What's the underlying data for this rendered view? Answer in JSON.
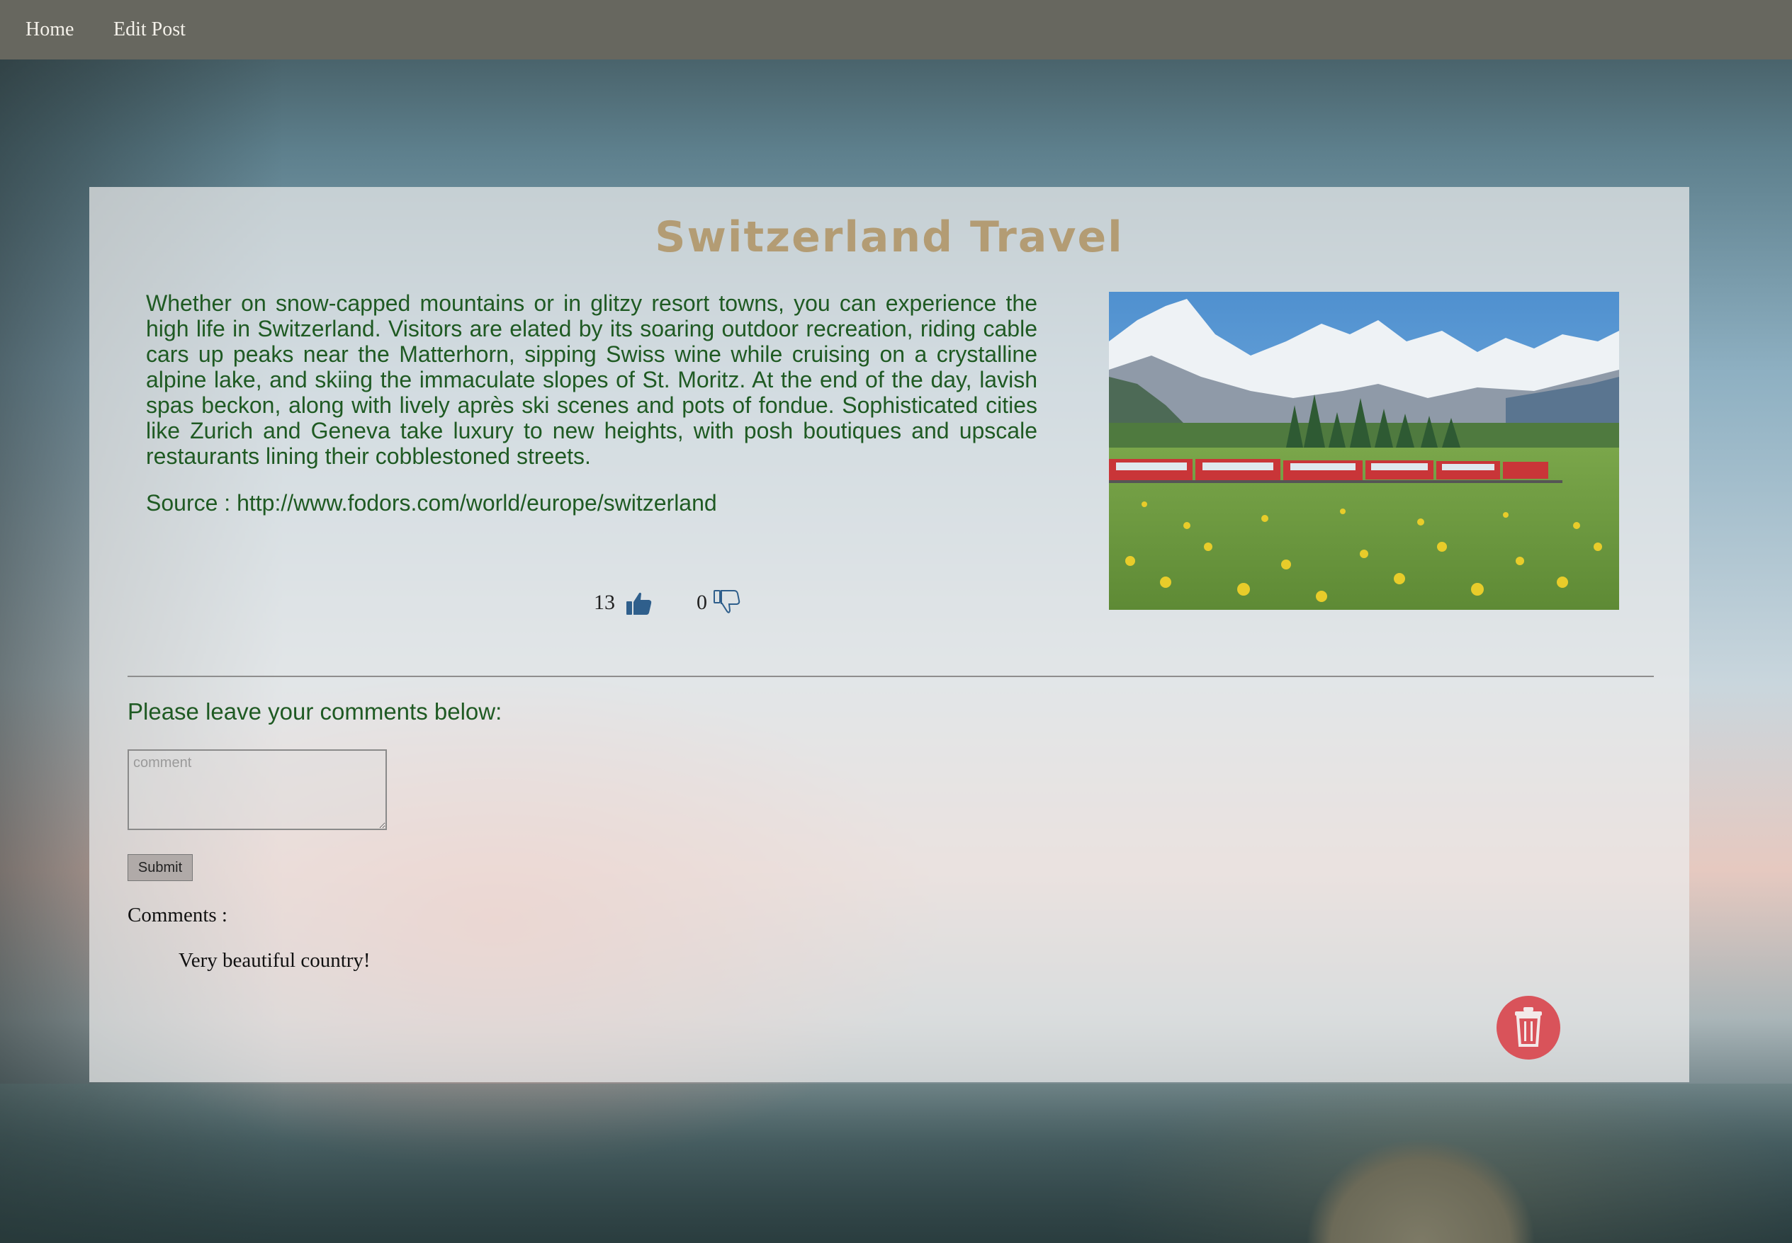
{
  "nav": {
    "home": "Home",
    "edit_post": "Edit Post"
  },
  "post": {
    "title": "Switzerland Travel",
    "description": "Whether on snow-capped mountains or in glitzy resort towns, you can experience the high life in Switzerland. Visitors are elated by its soaring outdoor recreation, riding cable cars up peaks near the Matterhorn, sipping Swiss wine while cruising on a crystalline alpine lake, and skiing the immaculate slopes of St. Moritz. At the end of the day, lavish spas beckon, along with lively après ski scenes and pots of fondue. Sophisticated cities like Zurich and Geneva take luxury to new heights, with posh boutiques and upscale restaurants lining their cobblestoned streets.",
    "source": "Source : http://www.fodors.com/world/europe/switzerland",
    "likes": "13",
    "dislikes": "0"
  },
  "comment_form": {
    "prompt": "Please leave your comments below:",
    "placeholder": "comment",
    "submit_label": "Submit"
  },
  "comments": {
    "label": "Comments :",
    "items": [
      "Very beautiful country!"
    ]
  },
  "icons": {
    "like": "thumbs-up-icon",
    "dislike": "thumbs-down-icon",
    "delete": "trash-icon"
  },
  "colors": {
    "navbar": "#67675f",
    "title": "#b39c74",
    "body_text": "#1f5a23",
    "like_icon": "#2f5f8c",
    "delete_button": "#d9535a"
  }
}
